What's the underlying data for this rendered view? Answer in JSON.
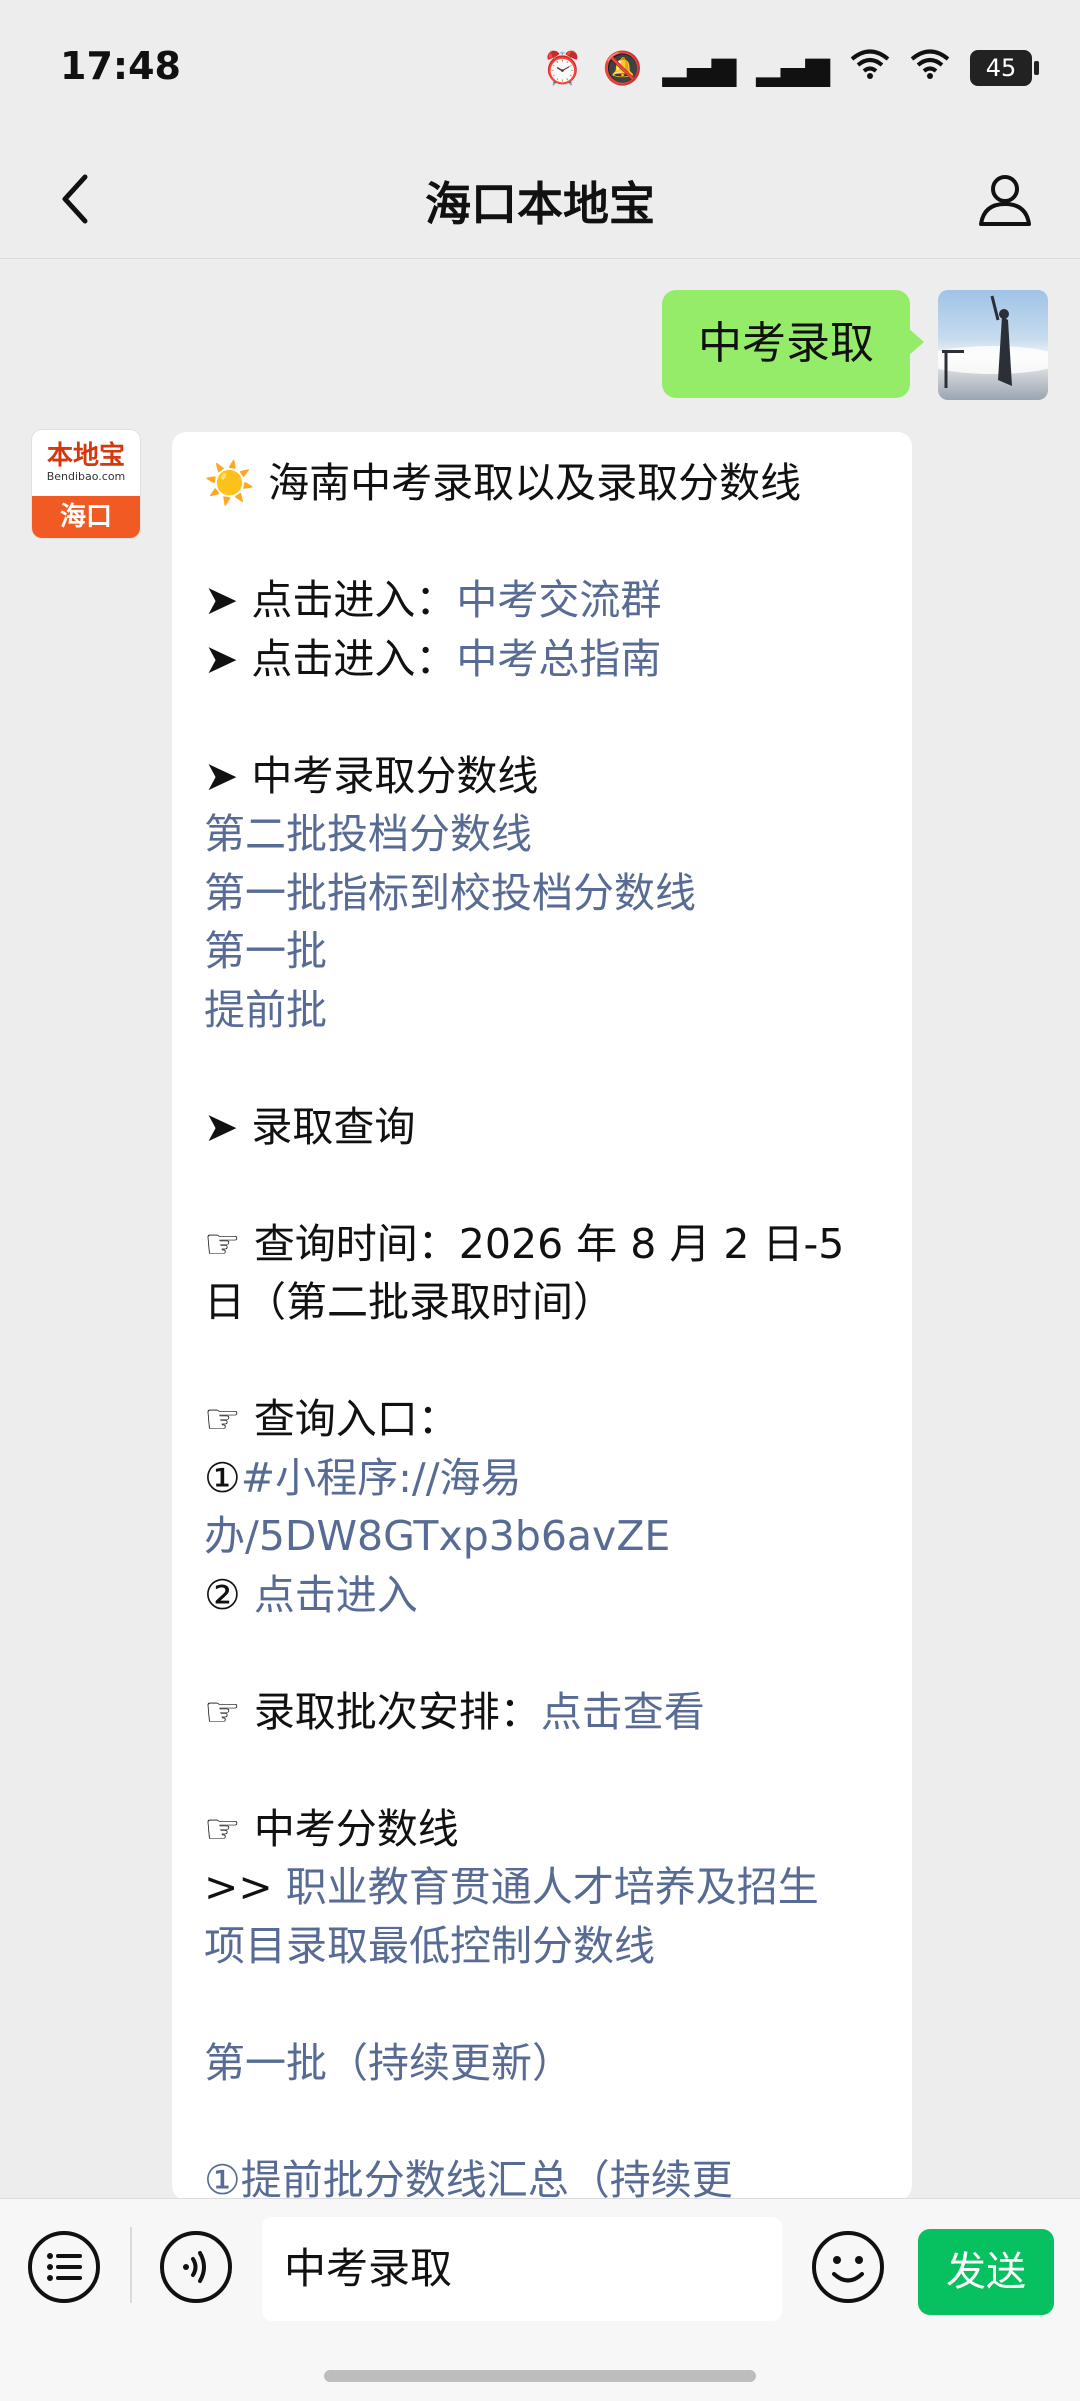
{
  "status_bar": {
    "time": "17:48",
    "battery": "45"
  },
  "header": {
    "title": "海口本地宝"
  },
  "user_message": {
    "text": "中考录取"
  },
  "bot_avatar": {
    "brand": "本地宝",
    "domain": "Bendibao.com",
    "city": "海口"
  },
  "bot_message": {
    "title_emoji": "☀️",
    "title": "海南中考录取以及录取分数线",
    "arrow": "➤",
    "hand": "☞",
    "enter1_label": "点击进入：",
    "enter1_link": "中考交流群",
    "enter2_label": "点击进入：",
    "enter2_link": "中考总指南",
    "score_heading": "中考录取分数线",
    "score_links": [
      "第二批投档分数线",
      "第一批指标到校投档分数线",
      "第一批",
      "提前批"
    ],
    "query_heading": "录取查询",
    "query_time_line1": "查询时间：2026 年 8 月 2 日-5",
    "query_time_line2": "日（第二批录取时间）",
    "query_entry_label": "查询入口：",
    "circle1": "①",
    "miniprogram_line1": "#小程序://海易",
    "miniprogram_line2": "办/5DW8GTxp3b6avZE",
    "circle2": "②",
    "entry2_link": "点击进入",
    "batch_label": "录取批次安排：",
    "batch_link": "点击查看",
    "score_line_heading": "中考分数线",
    "prefix": ">>",
    "vocational_line1": "职业教育贯通人才培养及招生",
    "vocational_line2": "项目录取最低控制分数线",
    "first_batch_update": "第一批（持续更新）",
    "cut_line": "①提前批分数线汇总（持续更"
  },
  "input_bar": {
    "input_value": "中考录取",
    "send_label": "发送"
  },
  "colors": {
    "link": "#576b95",
    "user_bubble": "#95ec69",
    "send_button": "#07c160",
    "background": "#ededed"
  }
}
